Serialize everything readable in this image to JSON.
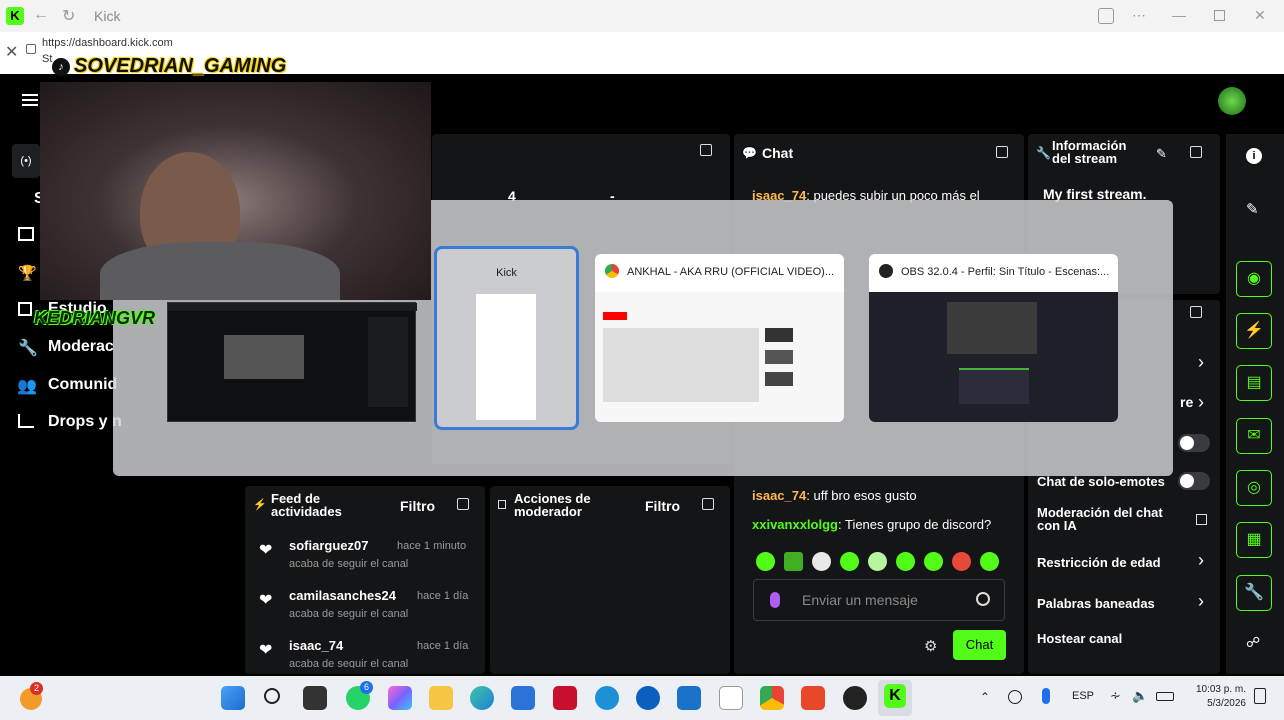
{
  "browser": {
    "tab_title": "Kick",
    "url": "https://dashboard.kick.com",
    "url_sub": "St"
  },
  "overlay": {
    "tiktok_handle": "SOVEDRIAN_GAMING",
    "watermark": "KEDRIANGVR"
  },
  "sidebar": {
    "items": [
      {
        "label": "S"
      },
      {
        "label": "Estudio"
      },
      {
        "label": "Moderac"
      },
      {
        "label": "Comunid"
      },
      {
        "label": "Drops y n"
      }
    ]
  },
  "stats_panel": {
    "value_a": "4",
    "value_b": "-"
  },
  "chat": {
    "title": "Chat",
    "messages": [
      {
        "user": "isaac_74",
        "text": "puedes subir un poco más el"
      },
      {
        "user": "isaac_74",
        "text": "uff bro esos gusto"
      },
      {
        "user": "xxivanxxlolgg",
        "text": "Tienes grupo de discord?"
      }
    ],
    "input_placeholder": "Enviar un mensaje",
    "send_label": "Chat"
  },
  "stream_info": {
    "title_line1": "Información",
    "title_line2": "del stream",
    "stream_title": "My first stream."
  },
  "settings": {
    "emote_only": "Chat de solo-emotes",
    "ai_mod_line1": "Moderación del chat",
    "ai_mod_line2": "con IA",
    "age_restriction": "Restricción de edad",
    "banned_words": "Palabras baneadas",
    "host": "Hostear canal",
    "partial": "re"
  },
  "activity_feed": {
    "title_line1": "Feed de",
    "title_line2": "actividades",
    "filter": "Filtro",
    "items": [
      {
        "user": "sofiarguez07",
        "time": "hace 1 minuto",
        "action": "acaba de seguir el canal"
      },
      {
        "user": "camilasanches24",
        "time": "hace 1 día",
        "action": "acaba de seguir el canal"
      },
      {
        "user": "isaac_74",
        "time": "hace 1 día",
        "action": "acaba de seguir el canal"
      }
    ]
  },
  "mod_actions": {
    "title_line1": "Acciones de",
    "title_line2": "moderador",
    "filter": "Filtro"
  },
  "switcher": {
    "windows": [
      {
        "title": "Kick"
      },
      {
        "title": "ANKHAL - AKA RRU (OFFICIAL VIDEO)..."
      },
      {
        "title": "OBS 32.0.4 - Perfil: Sin Título - Escenas:..."
      }
    ]
  },
  "taskbar": {
    "badge_weather": "2",
    "badge_whatsapp": "6",
    "lang": "ESP",
    "time": "10:03 p. m.",
    "date": "5/3/2026"
  },
  "colors": {
    "accent": "#53fc18",
    "bg": "#000000",
    "panel": "#141517",
    "switcher_focus": "#3a7bd5"
  }
}
